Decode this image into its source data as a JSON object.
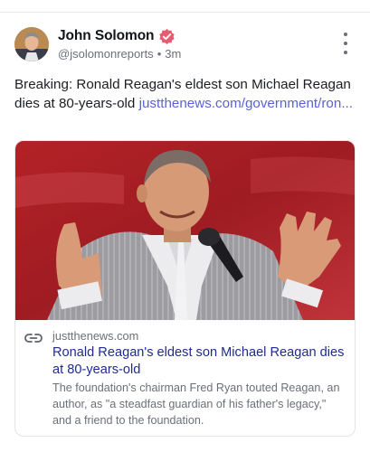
{
  "post": {
    "author_name": "John Solomon",
    "handle": "@jsolomonreports",
    "separator": "•",
    "time_ago": "3m",
    "text": "Breaking: Ronald Reagan's eldest son Michael Reagan dies at 80-years-old ",
    "link_text": "justthenews.com/government/ron...",
    "icons": {
      "verified": "verified-badge-icon",
      "more": "more-vertical-icon",
      "link": "link-icon"
    },
    "colors": {
      "link": "#5a62d6",
      "verified": "#e85a6f"
    }
  },
  "card": {
    "domain": "justthenews.com",
    "headline": "Ronald Reagan's eldest son Michael Reagan dies at 80-years-old",
    "description": "The foundation's chairman Fred Ryan touted Reagan, an author, as \"a steadfast guardian of his father's legacy,\" and a friend to the foundation."
  }
}
